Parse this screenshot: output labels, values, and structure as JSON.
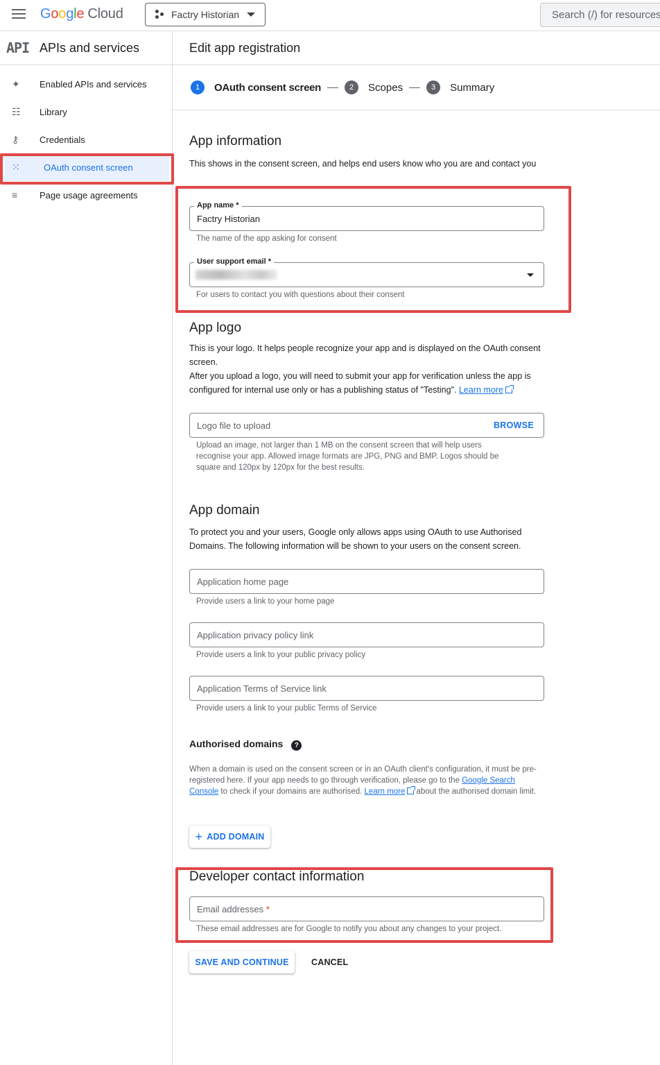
{
  "topbar": {
    "logo": {
      "g1": "G",
      "g2": "o",
      "g3": "o",
      "g4": "g",
      "g5": "l",
      "g6": "e",
      "product": "Cloud"
    },
    "project_name": "Factry Historian",
    "search_placeholder": "Search (/) for resources"
  },
  "sidebar": {
    "api_mark": "API",
    "title": "APIs and services",
    "items": [
      {
        "label": "Enabled APIs and services",
        "icon": "✦"
      },
      {
        "label": "Library",
        "icon": "☷"
      },
      {
        "label": "Credentials",
        "icon": "⚷"
      },
      {
        "label": "OAuth consent screen",
        "icon": "⁙"
      },
      {
        "label": "Page usage agreements",
        "icon": "≡"
      }
    ]
  },
  "main": {
    "title": "Edit app registration",
    "steps": [
      {
        "num": "1",
        "label": "OAuth consent screen"
      },
      {
        "num": "2",
        "label": "Scopes"
      },
      {
        "num": "3",
        "label": "Summary"
      }
    ]
  },
  "app_info": {
    "heading": "App information",
    "desc": "This shows in the consent screen, and helps end users know who you are and contact you",
    "app_name_label": "App name *",
    "app_name_value": "Factry Historian",
    "app_name_helper": "The name of the app asking for consent",
    "support_email_label": "User support email *",
    "support_email_helper": "For users to contact you with questions about their consent"
  },
  "app_logo": {
    "heading": "App logo",
    "desc1": "This is your logo. It helps people recognize your app and is displayed on the OAuth consent screen.",
    "desc2": "After you upload a logo, you will need to submit your app for verification unless the app is configured for internal use only or has a publishing status of \"Testing\".",
    "learn_more": "Learn more",
    "file_placeholder": "Logo file to upload",
    "browse": "BROWSE",
    "helper": "Upload an image, not larger than 1 MB on the consent screen that will help users recognise your app. Allowed image formats are JPG, PNG and BMP. Logos should be square and 120px by 120px for the best results."
  },
  "app_domain": {
    "heading": "App domain",
    "desc": "To protect you and your users, Google only allows apps using OAuth to use Authorised Domains. The following information will be shown to your users on the consent screen.",
    "home_placeholder": "Application home page",
    "home_helper": "Provide users a link to your home page",
    "privacy_placeholder": "Application privacy policy link",
    "privacy_helper": "Provide users a link to your public privacy policy",
    "tos_placeholder": "Application Terms of Service link",
    "tos_helper": "Provide users a link to your public Terms of Service"
  },
  "auth_domains": {
    "heading": "Authorised domains",
    "desc_part1": "When a domain is used on the consent screen or in an OAuth client's configuration, it must be pre-registered here. If your app needs to go through verification, please go to the",
    "link_search_console": "Google Search Console",
    "desc_part2": "to check if your domains are authorised.",
    "learn_more": "Learn more",
    "desc_part3": "about the authorised domain limit.",
    "add_domain": "ADD DOMAIN"
  },
  "developer": {
    "heading": "Developer contact information",
    "email_placeholder": "Email addresses",
    "required_star": "*",
    "helper": "These email addresses are for Google to notify you about any changes to your project."
  },
  "actions": {
    "save": "SAVE AND CONTINUE",
    "cancel": "CANCEL"
  },
  "colors": {
    "accent": "#1a73e8",
    "annotation_red": "#e04848"
  }
}
